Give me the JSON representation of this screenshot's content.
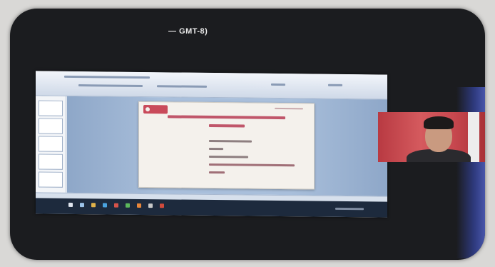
{
  "meeting": {
    "timezone_label": "— GMT-8)"
  },
  "colors": {
    "frame": "#1b1c1f",
    "slide_title": "#c0566a",
    "slide_logo": "#c94a5a",
    "webcam_background": "#c8484f"
  },
  "icons": {
    "presenter_logo": "university-logo-icon"
  }
}
